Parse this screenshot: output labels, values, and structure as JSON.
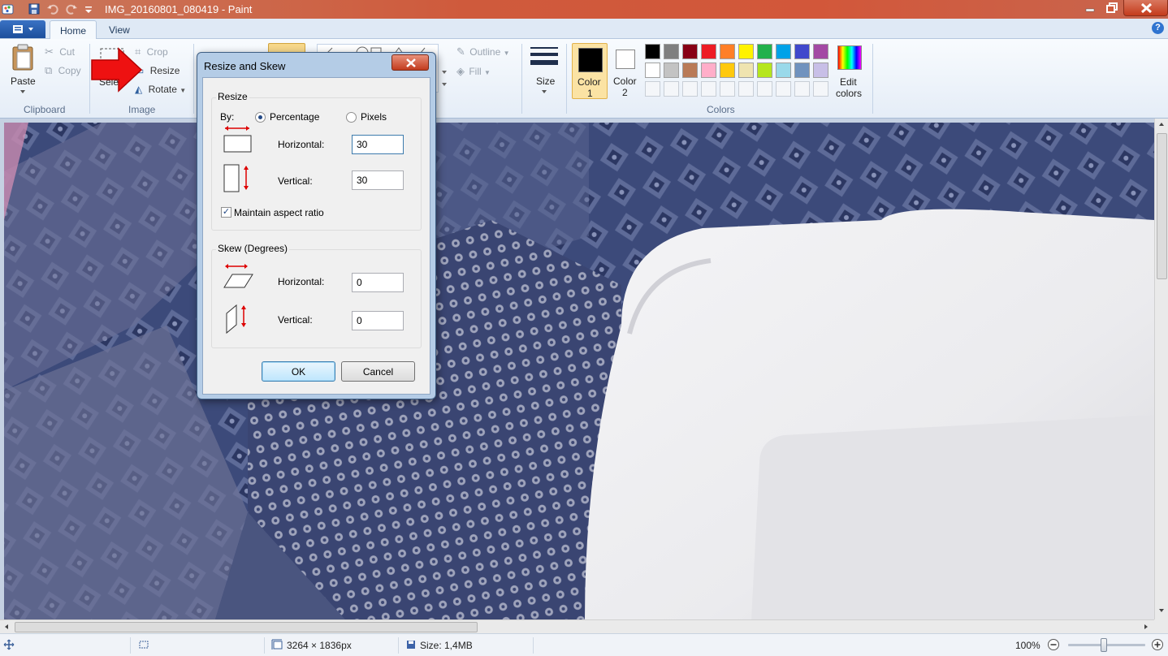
{
  "window": {
    "title": "IMG_20160801_080419 - Paint"
  },
  "tabs": [
    {
      "label": "Home"
    },
    {
      "label": "View"
    }
  ],
  "ribbon": {
    "clipboard": {
      "paste": "Paste",
      "cut": "Cut",
      "copy": "Copy",
      "group_title": "Clipboard"
    },
    "image": {
      "select": "Select",
      "crop": "Crop",
      "resize": "Resize",
      "rotate": "Rotate",
      "group_title": "Image"
    },
    "shapes": {
      "outline": "Outline",
      "fill": "Fill"
    },
    "size": {
      "label": "Size"
    },
    "colors": {
      "color1_label": "Color",
      "color1_num": "1",
      "color2_label": "Color",
      "color2_num": "2",
      "edit_colors_line1": "Edit",
      "edit_colors_line2": "colors",
      "group_title": "Colors",
      "color1_value": "#000000",
      "color2_value": "#ffffff",
      "palette_row1": [
        "#000000",
        "#7f7f7f",
        "#880015",
        "#ed1c24",
        "#ff7f27",
        "#fff200",
        "#22b14c",
        "#00a2e8",
        "#3f48cc",
        "#a349a4"
      ],
      "palette_row2": [
        "#ffffff",
        "#c3c3c3",
        "#b97a57",
        "#ffaec9",
        "#ffc90e",
        "#efe4b0",
        "#b5e61d",
        "#99d9ea",
        "#7092be",
        "#c8bfe7"
      ]
    }
  },
  "dialog": {
    "title": "Resize and Skew",
    "resize": {
      "group_title": "Resize",
      "by_label": "By:",
      "percentage_label": "Percentage",
      "pixels_label": "Pixels",
      "selected_mode": "Percentage",
      "horizontal_label": "Horizontal:",
      "horizontal_value": "30",
      "vertical_label": "Vertical:",
      "vertical_value": "30",
      "maintain_aspect_label": "Maintain aspect ratio",
      "maintain_aspect_checked": true
    },
    "skew": {
      "group_title": "Skew (Degrees)",
      "horizontal_label": "Horizontal:",
      "horizontal_value": "0",
      "vertical_label": "Vertical:",
      "vertical_value": "0"
    },
    "ok_label": "OK",
    "cancel_label": "Cancel"
  },
  "statusbar": {
    "dimensions": "3264 × 1836px",
    "size": "Size: 1,4MB",
    "zoom": "100%"
  }
}
